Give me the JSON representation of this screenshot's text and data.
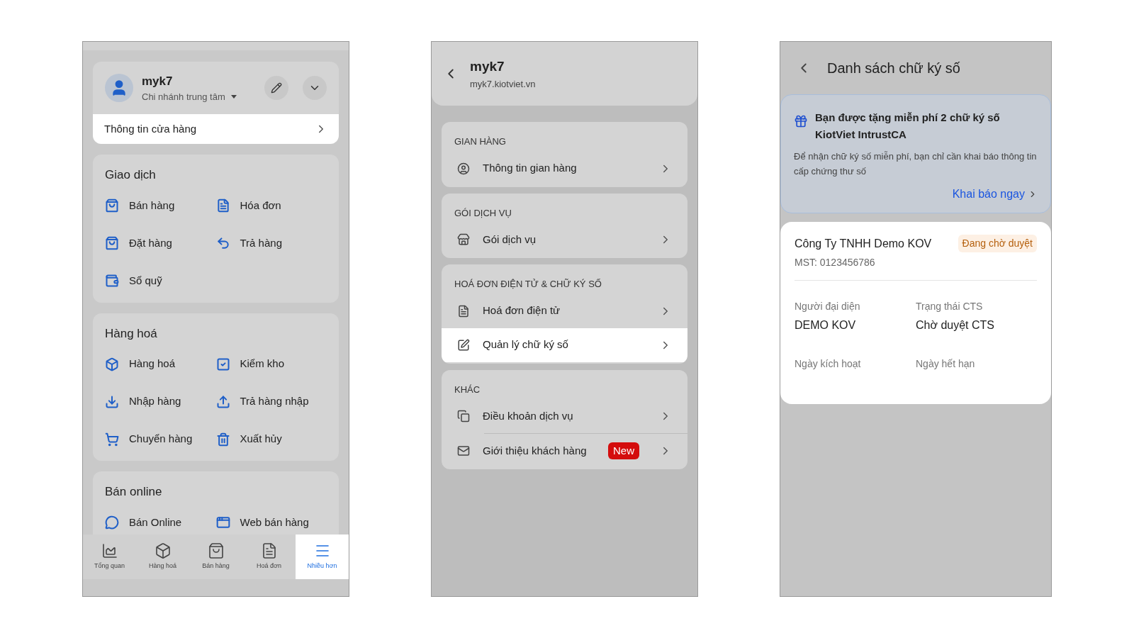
{
  "menu_screen": {
    "profile": {
      "name": "myk7",
      "branch": "Chi nhánh trung tâm"
    },
    "store_info_link": "Thông tin cửa hàng",
    "sections": [
      {
        "title": "Giao dịch",
        "items": [
          {
            "label": "Bán hàng"
          },
          {
            "label": "Hóa đơn"
          },
          {
            "label": "Đặt hàng"
          },
          {
            "label": "Trả hàng"
          },
          {
            "label": "Sổ quỹ"
          }
        ]
      },
      {
        "title": "Hàng hoá",
        "items": [
          {
            "label": "Hàng hoá"
          },
          {
            "label": "Kiểm kho"
          },
          {
            "label": "Nhập hàng"
          },
          {
            "label": "Trả hàng nhập"
          },
          {
            "label": "Chuyển hàng"
          },
          {
            "label": "Xuất hủy"
          }
        ]
      },
      {
        "title": "Bán online",
        "items": [
          {
            "label": "Bán Online"
          },
          {
            "label": "Web bán hàng"
          }
        ]
      }
    ],
    "tab_bar": [
      {
        "label": "Tổng quan",
        "selected": false
      },
      {
        "label": "Hàng hoá",
        "selected": false
      },
      {
        "label": "Bán hàng",
        "selected": false
      },
      {
        "label": "Hoá đơn",
        "selected": false
      },
      {
        "label": "Nhiều hơn",
        "selected": true
      }
    ]
  },
  "store_screen": {
    "header": {
      "title": "myk7",
      "subtitle": "myk7.kiotviet.vn"
    },
    "groups": [
      {
        "heading": "GIAN HÀNG",
        "items": [
          {
            "label": "Thông tin gian hàng",
            "selected": false
          }
        ]
      },
      {
        "heading": "GÓI DỊCH VỤ",
        "items": [
          {
            "label": "Gói dịch vụ",
            "selected": false
          }
        ]
      },
      {
        "heading": "HOÁ ĐƠN ĐIỆN TỬ & CHỮ KÝ SỐ",
        "items": [
          {
            "label": "Hoá đơn điện tử",
            "selected": false
          },
          {
            "label": "Quản lý chữ ký số",
            "selected": true
          }
        ]
      },
      {
        "heading": "KHÁC",
        "items": [
          {
            "label": "Điều khoản dịch vụ",
            "selected": false
          },
          {
            "label": "Giới thiệu khách hàng",
            "selected": false,
            "badge": "New"
          }
        ]
      }
    ]
  },
  "signature_screen": {
    "title": "Danh sách chữ ký số",
    "promo": {
      "title": "Bạn được tặng miễn phí 2 chữ ký số KiotViet IntrustCA",
      "body": "Để nhận chữ ký số miễn phí, bạn chỉ cần khai báo thông tin cấp chứng thư số",
      "link": "Khai báo ngay"
    },
    "card": {
      "company": "Công Ty TNHH Demo KOV",
      "status": "Đang chờ duyệt",
      "tax_id": "MST: 0123456786",
      "fields": [
        {
          "label": "Người đại diện",
          "value": "DEMO KOV"
        },
        {
          "label": "Trạng thái CTS",
          "value": "Chờ duyệt CTS"
        },
        {
          "label": "Ngày kích hoạt"
        },
        {
          "label": "Ngày hết hạn"
        }
      ]
    }
  }
}
